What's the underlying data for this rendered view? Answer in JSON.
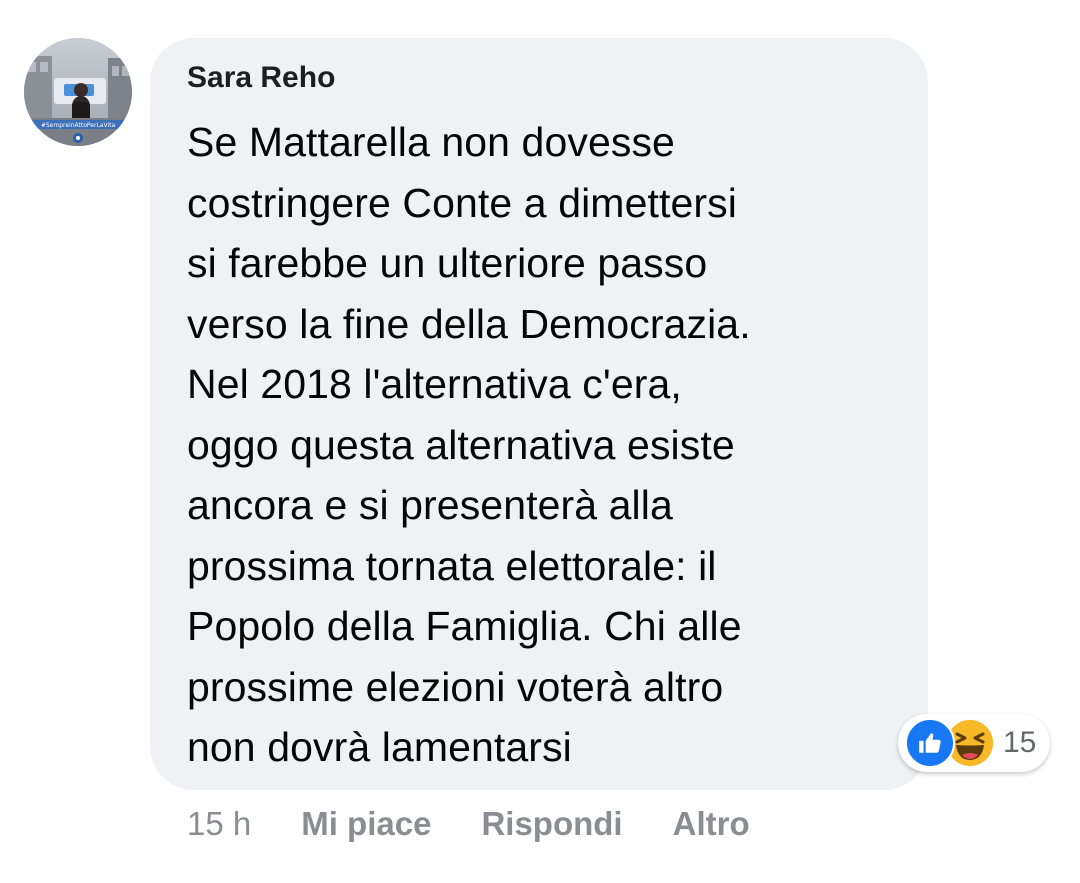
{
  "comment": {
    "author": "Sara Reho",
    "text": "Se Mattarella non dovesse\ncostringere Conte a dimettersi\nsi farebbe un ulteriore passo\nverso la fine della Democrazia.\nNel 2018 l'alternativa c'era,\noggo questa alternativa esiste\nancora e si presenterà alla\nprossima tornata elettorale: il\nPopolo della Famiglia. Chi alle\nprossime elezioni voterà altro\nnon dovrà lamentarsi",
    "avatar_caption": "#SempreinAttoPerLaVita"
  },
  "reactions": {
    "icons": [
      "like-icon",
      "haha-icon"
    ],
    "count": "15",
    "like_color": "#1877f2",
    "haha_color": "#f7b928"
  },
  "actions": {
    "time": "15 h",
    "like": "Mi piace",
    "reply": "Rispondi",
    "more": "Altro"
  },
  "colors": {
    "bubble": "#eff1f5",
    "meta_text": "#8a8d91"
  }
}
